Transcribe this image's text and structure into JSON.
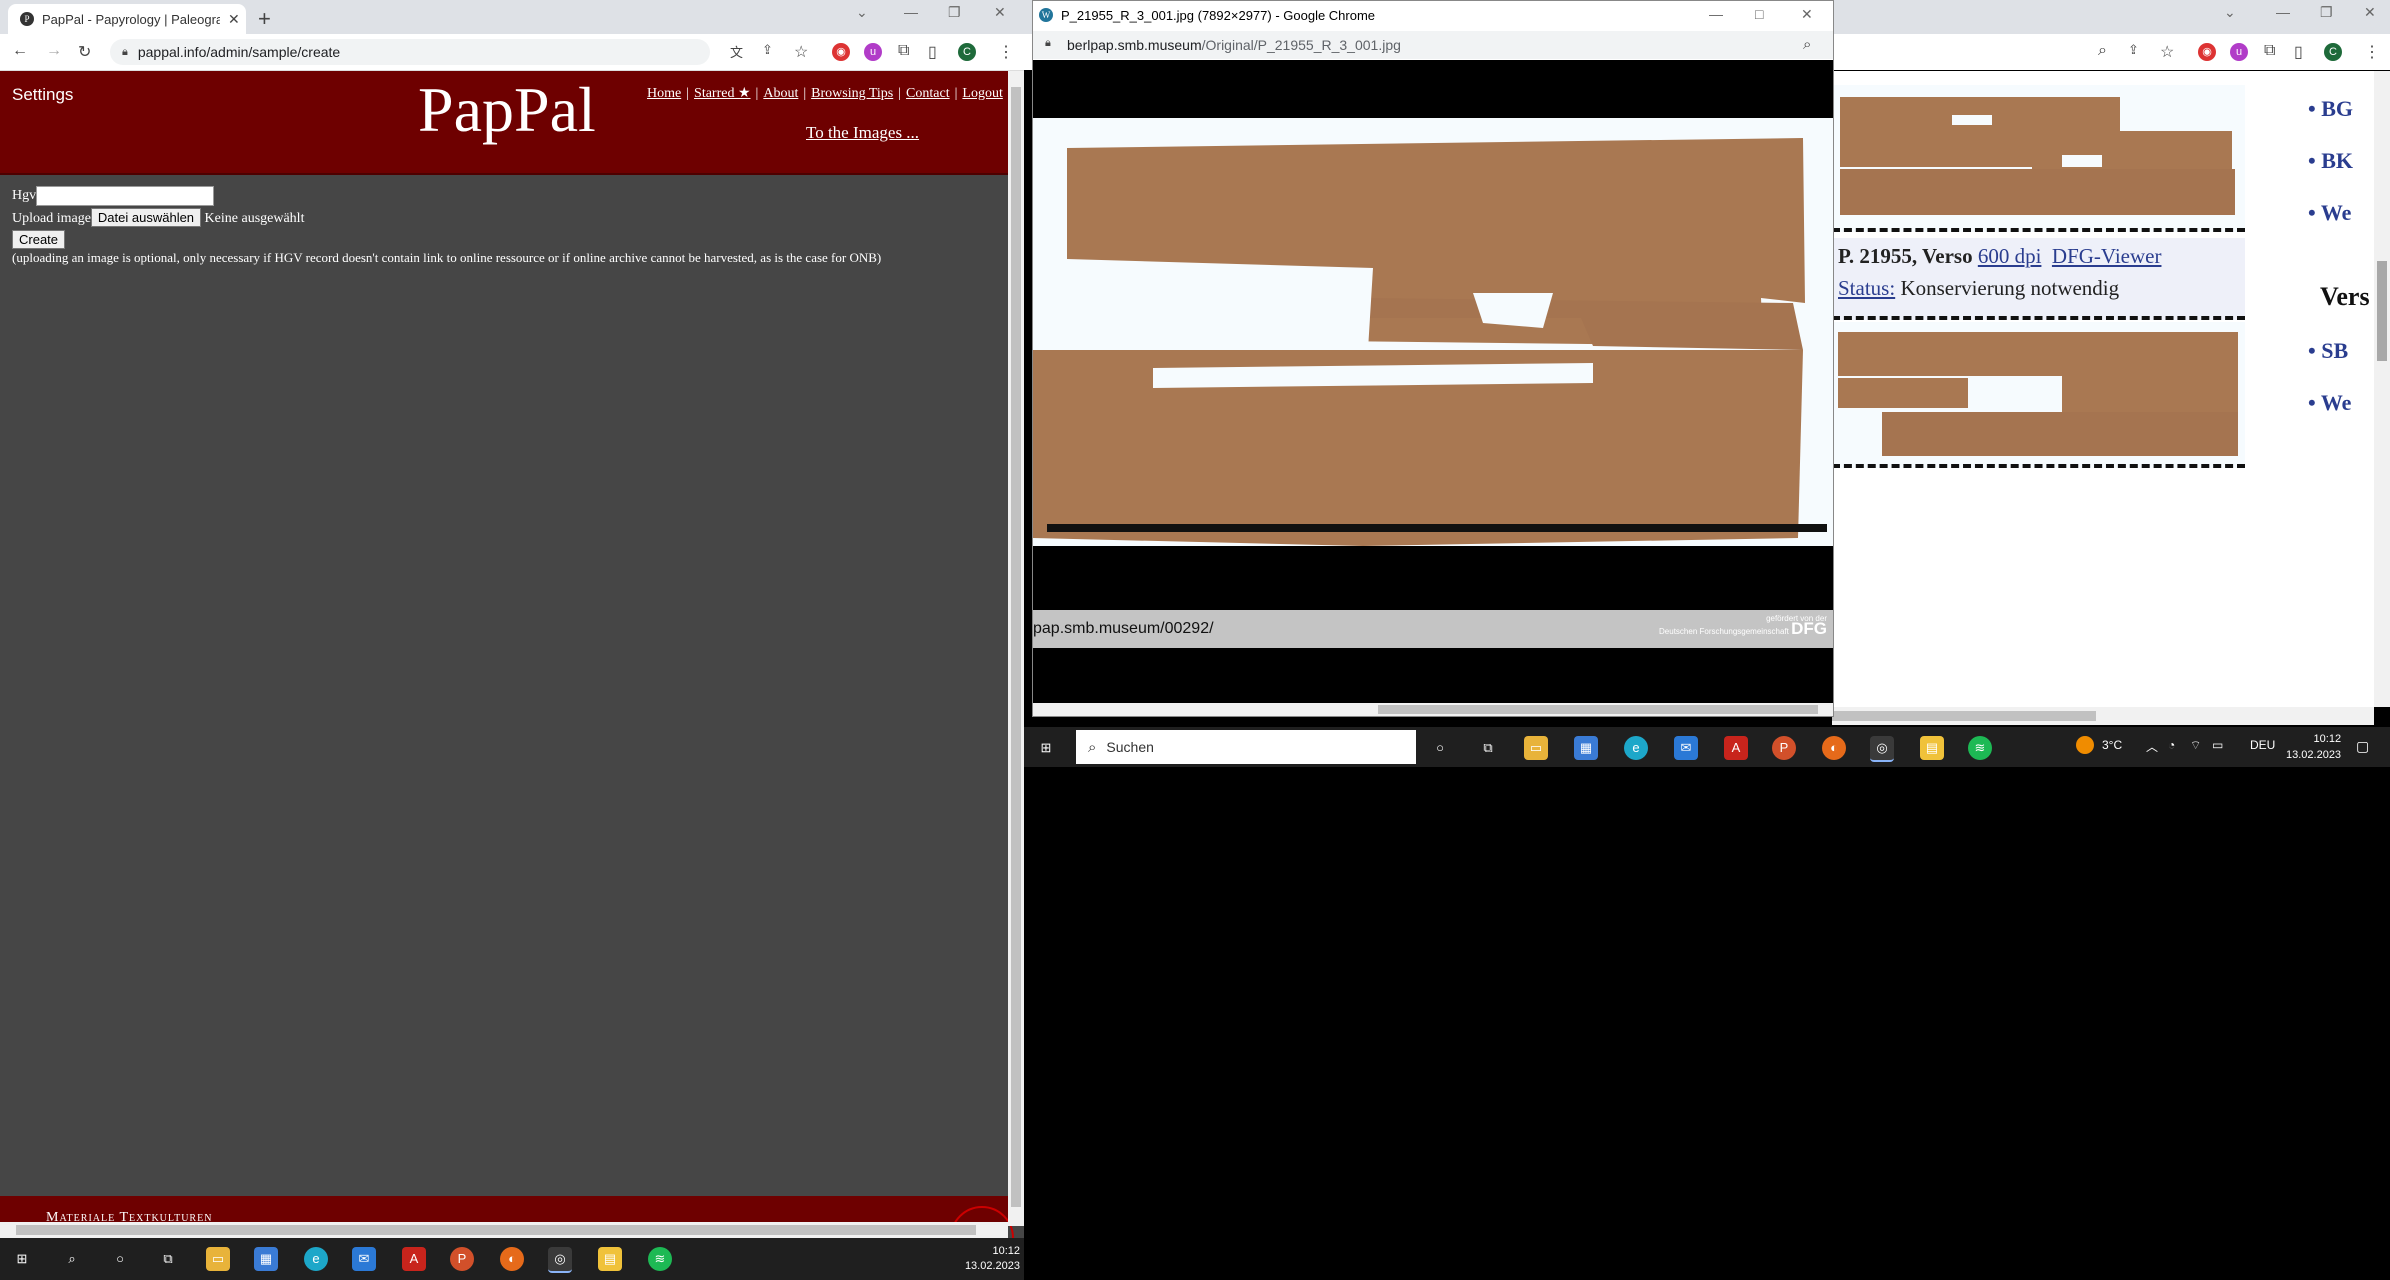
{
  "left_window": {
    "tab_title": "PapPal - Papyrology | Paleograph",
    "url": "pappal.info/admin/sample/create",
    "profile_initial": "C",
    "header": {
      "settings": "Settings",
      "logo": "PapPal",
      "nav": [
        "Home",
        "Starred ★",
        "About",
        "Browsing Tips",
        "Contact",
        "Logout"
      ],
      "nav_sep": "|",
      "images_link": "To the Images ..."
    },
    "form": {
      "hgv_label": "Hgv",
      "hgv_value": "",
      "upload_label": "Upload image",
      "file_button": "Datei auswählen",
      "file_status": "Keine ausgewählt",
      "create_button": "Create",
      "note": "(uploading an image is optional, only necessary if HGV record doesn't contain link to online ressource or if online archive cannot be harvested, as is the case for ONB)"
    },
    "footer_text": "Materiale Textkulturen"
  },
  "taskbar_left": {
    "time": "10:12",
    "date": "13.02.2023"
  },
  "popup_window": {
    "title": "P_21955_R_3_001.jpg (7892×2977) - Google Chrome",
    "url_host": "berlpap.smb.museum",
    "url_path": "/Original/P_21955_R_3_001.jpg",
    "image_footer_url": "pap.smb.museum/00292/",
    "dfg_small": "gefördert von der",
    "dfg_org": "Deutschen Forschungsgemeinschaft",
    "dfg_logo": "DFG"
  },
  "background_page": {
    "profile_initial": "C",
    "list_top": [
      "BG",
      "BK",
      "We"
    ],
    "verso_caption": "P. 21955, Verso",
    "link_dpi": "600 dpi",
    "link_viewer": "DFG-Viewer",
    "status_label": "Status:",
    "status_value": "Konservierung notwendig",
    "section_heading": "Vers",
    "list_bottom": [
      "SB",
      "We"
    ]
  },
  "taskbar_right": {
    "search_label": "Suchen",
    "weather": "3°C",
    "lang": "DEU",
    "time": "10:12",
    "date": "13.02.2023"
  }
}
